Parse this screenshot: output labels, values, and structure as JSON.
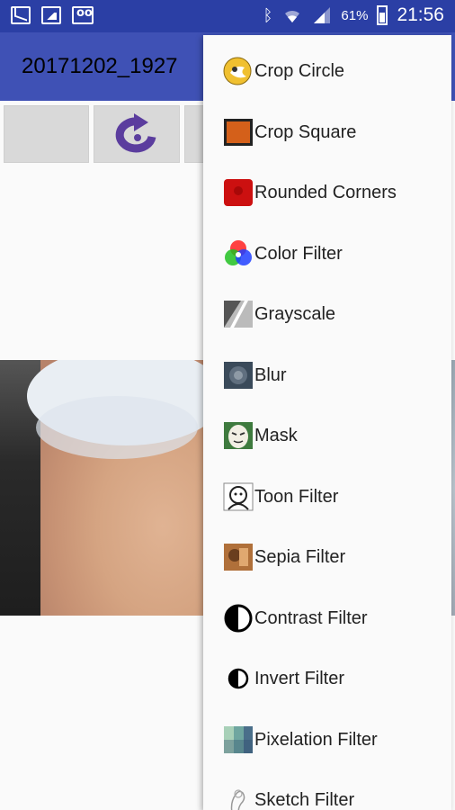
{
  "status_bar": {
    "battery_level": "61%",
    "time": "21:56"
  },
  "app_bar": {
    "title": "20171202_1927"
  },
  "menu": {
    "items": [
      {
        "label": "Crop Circle",
        "icon": "crop-circle-icon"
      },
      {
        "label": "Crop Square",
        "icon": "crop-square-icon"
      },
      {
        "label": "Rounded Corners",
        "icon": "rounded-corners-icon"
      },
      {
        "label": "Color Filter",
        "icon": "color-filter-icon"
      },
      {
        "label": "Grayscale",
        "icon": "grayscale-icon"
      },
      {
        "label": "Blur",
        "icon": "blur-icon"
      },
      {
        "label": "Mask",
        "icon": "mask-icon"
      },
      {
        "label": "Toon Filter",
        "icon": "toon-filter-icon"
      },
      {
        "label": "Sepia Filter",
        "icon": "sepia-filter-icon"
      },
      {
        "label": "Contrast Filter",
        "icon": "contrast-filter-icon"
      },
      {
        "label": "Invert Filter",
        "icon": "invert-filter-icon"
      },
      {
        "label": "Pixelation Filter",
        "icon": "pixelation-filter-icon"
      },
      {
        "label": "Sketch Filter",
        "icon": "sketch-filter-icon"
      }
    ]
  },
  "colors": {
    "status_bar": "#2b3fa5",
    "app_bar": "#3f51b5",
    "rotate_icon": "#5b3d9e",
    "menu_background": "#fafafa"
  }
}
